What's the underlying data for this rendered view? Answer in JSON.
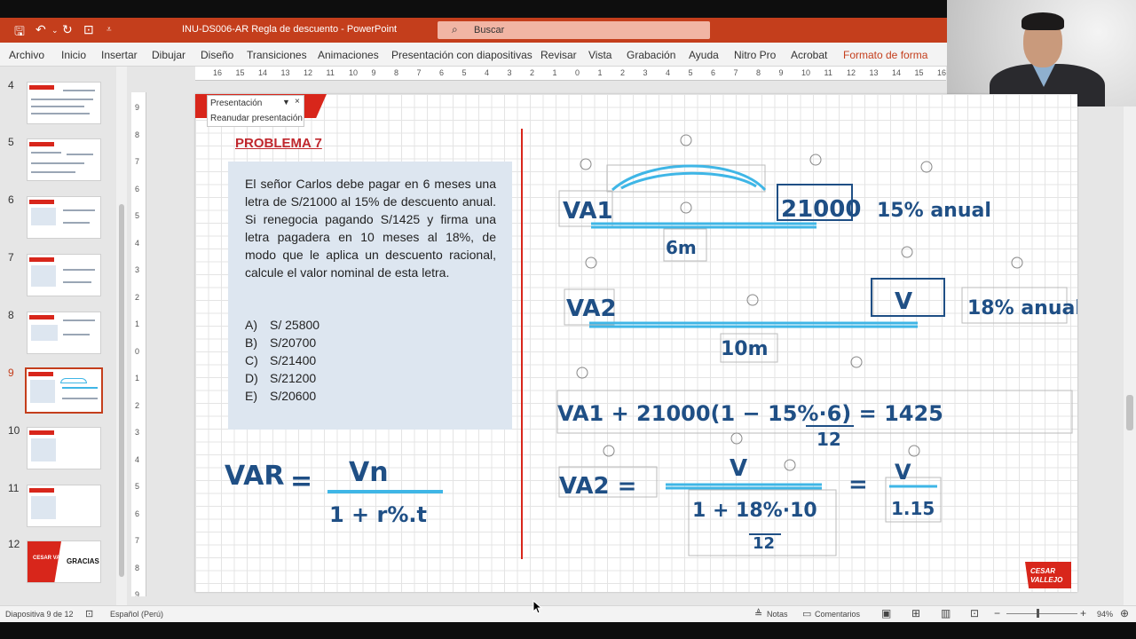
{
  "app": {
    "doc_title": "INU-DS006-AR Regla de descuento  -  PowerPoint",
    "search_placeholder": "Buscar"
  },
  "menu": [
    "Archivo",
    "Inicio",
    "Insertar",
    "Dibujar",
    "Diseño",
    "Transiciones",
    "Animaciones",
    "Presentación con diapositivas",
    "Revisar",
    "Vista",
    "Grabación",
    "Ayuda",
    "Nitro Pro",
    "Acrobat",
    "Formato de forma"
  ],
  "slides": {
    "numbers": [
      "4",
      "5",
      "6",
      "7",
      "8",
      "9",
      "10",
      "11",
      "12"
    ],
    "selected": "9",
    "last_thumb_text": "GRACIAS",
    "last_thumb_logo": "CESAR VALLEJO"
  },
  "ruler": {
    "h": [
      "16",
      "15",
      "14",
      "13",
      "12",
      "11",
      "10",
      "9",
      "8",
      "7",
      "6",
      "5",
      "4",
      "3",
      "2",
      "1",
      "0",
      "1",
      "2",
      "3",
      "4",
      "5",
      "6",
      "7",
      "8",
      "9",
      "10",
      "11",
      "12",
      "13",
      "14",
      "15",
      "16"
    ],
    "v": [
      "9",
      "8",
      "7",
      "6",
      "5",
      "4",
      "3",
      "2",
      "1",
      "0",
      "1",
      "2",
      "3",
      "4",
      "5",
      "6",
      "7",
      "8",
      "9"
    ]
  },
  "popup": {
    "title": "Presentación",
    "action": "Reanudar presentación",
    "close": "×"
  },
  "problem": {
    "title": "PROBLEMA 7",
    "text": "El señor Carlos debe pagar en 6 meses una letra de S/21000 al 15% de descuento anual. Si renegocia pagando S/1425 y firma una letra pagadera en 10 meses al 18%, de modo que le aplica un descuento racional, calcule el valor nominal de esta letra.",
    "options": [
      {
        "letter": "A)",
        "value": "S/ 25800"
      },
      {
        "letter": "B)",
        "value": "S/20700"
      },
      {
        "letter": "C)",
        "value": "S/21400"
      },
      {
        "letter": "D)",
        "value": "S/21200"
      },
      {
        "letter": "E)",
        "value": "S/20600"
      }
    ]
  },
  "formula": {
    "lhs": "VAR",
    "eq": "=",
    "num": "Vn",
    "den": "1 + r%.t"
  },
  "handwriting": {
    "va1": "VA1",
    "amount1": "21000",
    "rate1": "15% anual",
    "months1": "6m",
    "va2": "VA2",
    "v": "V",
    "rate2": "18% anual",
    "months2": "10m",
    "line3": "VA1 + 21000(1 − 15%·6) = 1425",
    "line3_den": "12",
    "line4_lhs": "VA2 =",
    "line4_num": "V",
    "line4_den": "1 + 18%·10",
    "line4_den2": "12",
    "line4_rhs_num": "V",
    "line4_rhs_den": "1.15"
  },
  "logo": {
    "line1": "CESAR",
    "line2": "VALLEJO"
  },
  "status": {
    "slide": "Diapositiva 9 de 12",
    "lang": "Español (Perú)",
    "notes": "Notas",
    "comments": "Comentarios",
    "zoom": "94%"
  },
  "colors": {
    "accent": "#c43e1c",
    "slide_red": "#d8261b",
    "ink": "#1f4f85",
    "highlight": "#3fb6e6"
  }
}
